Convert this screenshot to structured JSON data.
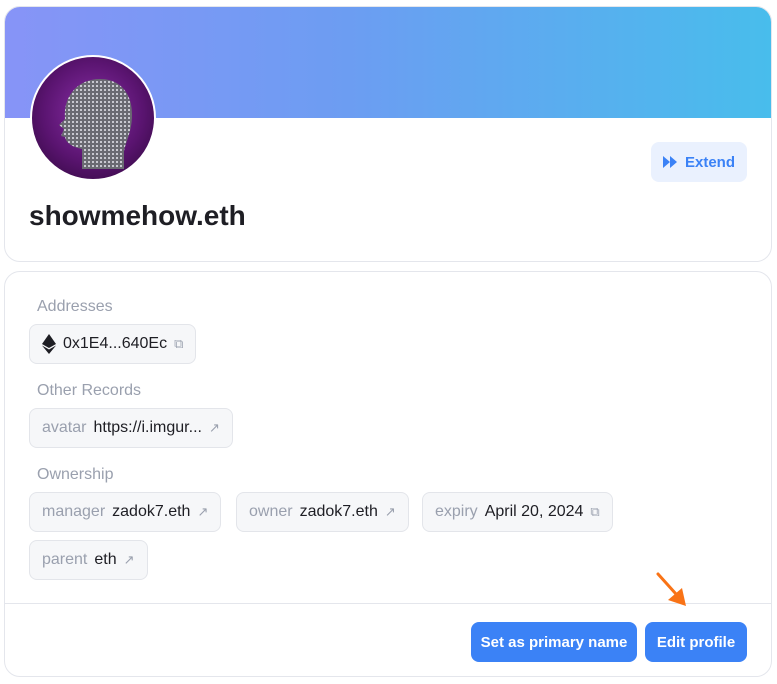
{
  "profile": {
    "name": "showmehow.eth",
    "extend_label": "Extend",
    "banner_gradient": [
      "#8794f7",
      "#48bdec"
    ]
  },
  "addresses": {
    "title": "Addresses",
    "eth_address": "0x1E4...640Ec",
    "icon": "ethereum-icon"
  },
  "other_records": {
    "title": "Other Records",
    "avatar_key": "avatar",
    "avatar_value": "https://i.imgur..."
  },
  "ownership": {
    "title": "Ownership",
    "manager_key": "manager",
    "manager_value": "zadok7.eth",
    "owner_key": "owner",
    "owner_value": "zadok7.eth",
    "expiry_key": "expiry",
    "expiry_value": "April 20, 2024",
    "parent_key": "parent",
    "parent_value": "eth"
  },
  "actions": {
    "set_primary_label": "Set as primary name",
    "edit_profile_label": "Edit profile"
  },
  "colors": {
    "accent": "#3b82f6",
    "annotation_arrow": "#f97316"
  }
}
